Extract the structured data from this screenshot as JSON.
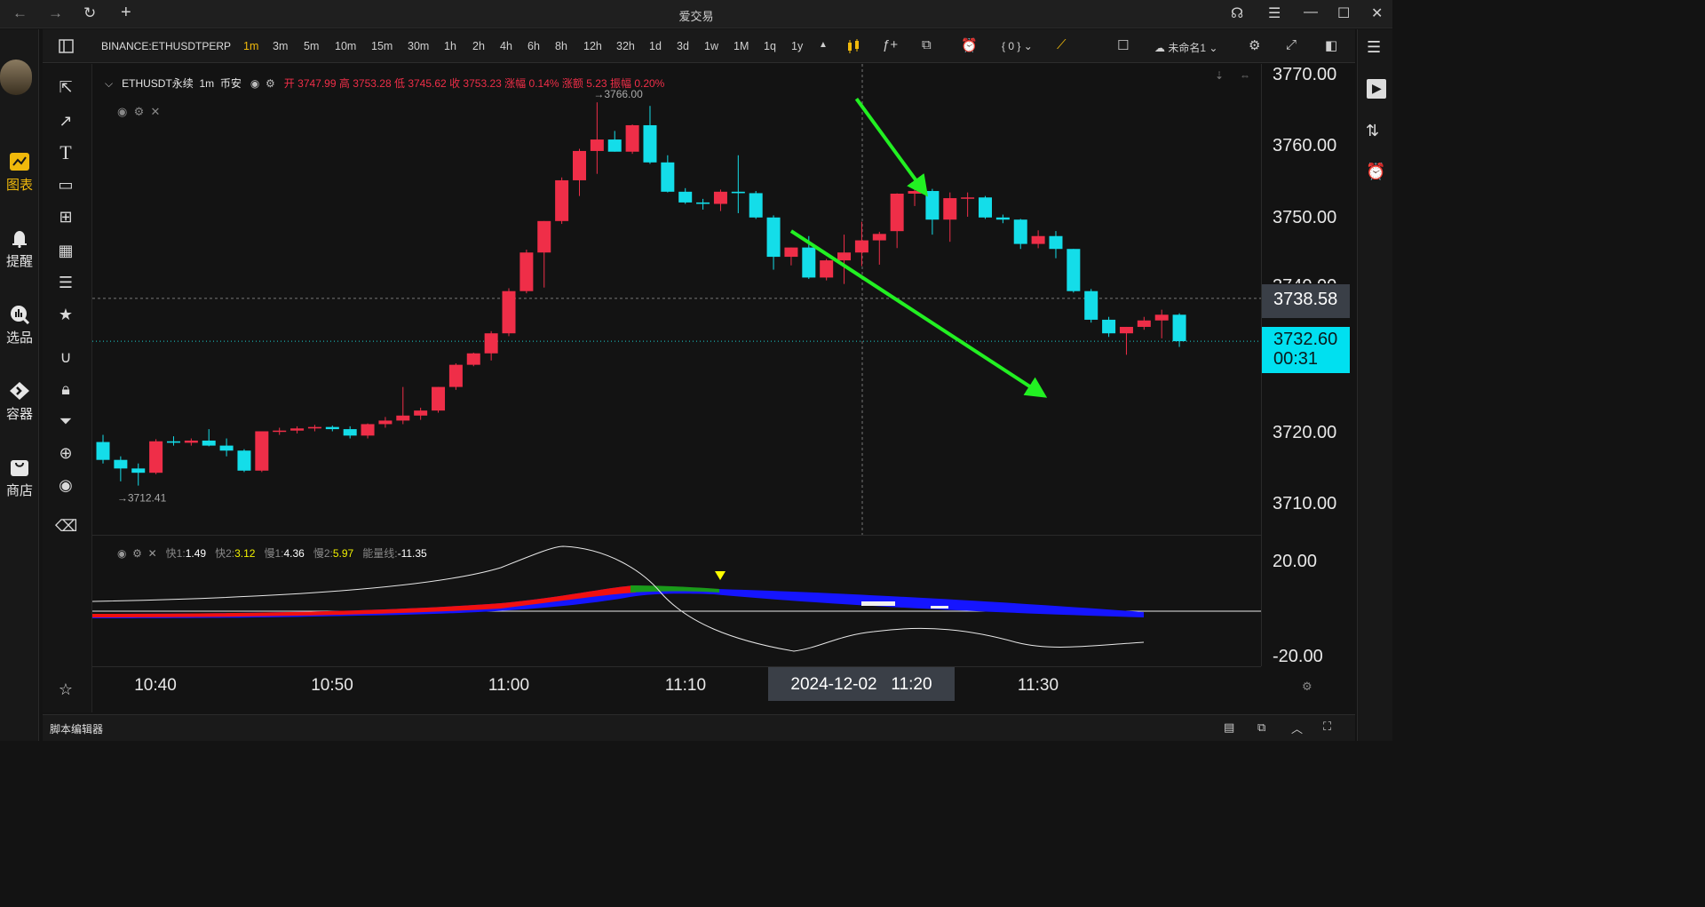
{
  "window": {
    "title": "爱交易"
  },
  "left_nav": [
    {
      "label": "图表",
      "active": true,
      "icon": "chart-icon"
    },
    {
      "label": "提醒",
      "active": false,
      "icon": "bell-icon"
    },
    {
      "label": "选品",
      "active": false,
      "icon": "stock-picker-icon"
    },
    {
      "label": "容器",
      "active": false,
      "icon": "container-icon"
    },
    {
      "label": "商店",
      "active": false,
      "icon": "store-icon"
    }
  ],
  "toolbar": {
    "symbol": "BINANCE:ETHUSDTPERP",
    "timeframes": [
      "1m",
      "3m",
      "5m",
      "10m",
      "15m",
      "30m",
      "1h",
      "2h",
      "4h",
      "6h",
      "8h",
      "12h",
      "32h",
      "1d",
      "3d",
      "1w",
      "1M",
      "1q",
      "1y"
    ],
    "active_timeframe": "1m",
    "indicator_count": "{ 0 }",
    "layout_name": "未命名1"
  },
  "legend": {
    "name": "ETHUSDT永续",
    "interval": "1m",
    "exchange": "币安",
    "open_label": "开",
    "open": "3747.99",
    "high_label": "高",
    "high": "3753.28",
    "low_label": "低",
    "low": "3745.62",
    "close_label": "收",
    "close": "3753.23",
    "chg_pct_label": "涨幅",
    "chg_pct": "0.14%",
    "chg_label": "涨额",
    "chg": "5.23",
    "amp_label": "振幅",
    "amp": "0.20%"
  },
  "indicator": {
    "fast1_label": "快1:",
    "fast1": "1.49",
    "fast2_label": "快2:",
    "fast2": "3.12",
    "slow1_label": "慢1:",
    "slow1": "4.36",
    "slow2_label": "慢2:",
    "slow2": "5.97",
    "energy_label": "能量线:",
    "energy": "-11.35",
    "axis_top": "20.00",
    "axis_bottom": "-20.00"
  },
  "price_axis": [
    "3770.00",
    "3760.00",
    "3750.00",
    "3740.00",
    "3720.00",
    "3710.00"
  ],
  "crosshair_price": "3738.58",
  "last_price": "3732.60",
  "countdown": "00:31",
  "time_axis": [
    "10:40",
    "10:50",
    "11:00",
    "11:10",
    "11:30"
  ],
  "crosshair_time": "2024-12-02   11:20",
  "annotations": {
    "high_mark": "→3766.00",
    "low_mark": "→3712.41"
  },
  "status_bar": {
    "script_editor": "脚本编辑器"
  },
  "colors": {
    "up": "#ef2e48",
    "down": "#14dde9",
    "accent": "#f0b90b",
    "arrow": "#22f022",
    "last_price_bg": "#00e0f0"
  },
  "chart_data": {
    "type": "candlestick",
    "interval": "1m",
    "start_time": "10:37",
    "ylim": [
      3705,
      3770
    ],
    "candles": [
      {
        "o": 3718.5,
        "h": 3719.5,
        "l": 3715.5,
        "c": 3716.0
      },
      {
        "o": 3716.0,
        "h": 3716.5,
        "l": 3713.0,
        "c": 3714.8
      },
      {
        "o": 3714.8,
        "h": 3715.5,
        "l": 3712.41,
        "c": 3714.2
      },
      {
        "o": 3714.2,
        "h": 3718.9,
        "l": 3714.0,
        "c": 3718.6
      },
      {
        "o": 3718.6,
        "h": 3719.3,
        "l": 3718.0,
        "c": 3718.4
      },
      {
        "o": 3718.4,
        "h": 3719.0,
        "l": 3718.0,
        "c": 3718.7
      },
      {
        "o": 3718.7,
        "h": 3720.3,
        "l": 3717.9,
        "c": 3718.0
      },
      {
        "o": 3718.0,
        "h": 3719.0,
        "l": 3716.5,
        "c": 3717.3
      },
      {
        "o": 3717.3,
        "h": 3717.5,
        "l": 3714.3,
        "c": 3714.5
      },
      {
        "o": 3714.5,
        "h": 3720.0,
        "l": 3714.3,
        "c": 3720.0
      },
      {
        "o": 3720.0,
        "h": 3720.5,
        "l": 3719.5,
        "c": 3720.1
      },
      {
        "o": 3720.1,
        "h": 3720.7,
        "l": 3719.7,
        "c": 3720.4
      },
      {
        "o": 3720.4,
        "h": 3720.9,
        "l": 3720.0,
        "c": 3720.6
      },
      {
        "o": 3720.6,
        "h": 3720.8,
        "l": 3720.0,
        "c": 3720.3
      },
      {
        "o": 3720.3,
        "h": 3720.7,
        "l": 3719.0,
        "c": 3719.4
      },
      {
        "o": 3719.4,
        "h": 3721.1,
        "l": 3719.0,
        "c": 3721.0
      },
      {
        "o": 3721.0,
        "h": 3722.0,
        "l": 3720.5,
        "c": 3721.5
      },
      {
        "o": 3721.5,
        "h": 3726.2,
        "l": 3721.0,
        "c": 3722.2
      },
      {
        "o": 3722.2,
        "h": 3723.3,
        "l": 3721.6,
        "c": 3722.9
      },
      {
        "o": 3722.9,
        "h": 3726.2,
        "l": 3722.6,
        "c": 3726.2
      },
      {
        "o": 3726.2,
        "h": 3729.5,
        "l": 3725.8,
        "c": 3729.3
      },
      {
        "o": 3729.3,
        "h": 3731.0,
        "l": 3729.1,
        "c": 3730.9
      },
      {
        "o": 3730.9,
        "h": 3734.0,
        "l": 3729.9,
        "c": 3733.7
      },
      {
        "o": 3733.7,
        "h": 3740.0,
        "l": 3733.3,
        "c": 3739.6
      },
      {
        "o": 3739.6,
        "h": 3745.4,
        "l": 3739.3,
        "c": 3745.0
      },
      {
        "o": 3745.0,
        "h": 3749.4,
        "l": 3740.1,
        "c": 3749.4
      },
      {
        "o": 3749.4,
        "h": 3755.5,
        "l": 3749.0,
        "c": 3755.1
      },
      {
        "o": 3755.1,
        "h": 3759.5,
        "l": 3752.9,
        "c": 3759.2
      },
      {
        "o": 3759.2,
        "h": 3766.0,
        "l": 3756.0,
        "c": 3760.8
      },
      {
        "o": 3760.8,
        "h": 3762.0,
        "l": 3759.1,
        "c": 3759.1
      },
      {
        "o": 3759.1,
        "h": 3762.9,
        "l": 3758.8,
        "c": 3762.8
      },
      {
        "o": 3762.8,
        "h": 3765.5,
        "l": 3757.4,
        "c": 3757.6
      },
      {
        "o": 3757.6,
        "h": 3758.6,
        "l": 3753.4,
        "c": 3753.5
      },
      {
        "o": 3753.5,
        "h": 3754.0,
        "l": 3751.8,
        "c": 3752.0
      },
      {
        "o": 3752.0,
        "h": 3752.5,
        "l": 3751.0,
        "c": 3751.8
      },
      {
        "o": 3751.8,
        "h": 3753.8,
        "l": 3750.8,
        "c": 3753.5
      },
      {
        "o": 3753.5,
        "h": 3758.6,
        "l": 3750.5,
        "c": 3753.3
      },
      {
        "o": 3753.3,
        "h": 3753.6,
        "l": 3749.7,
        "c": 3749.9
      },
      {
        "o": 3749.9,
        "h": 3750.2,
        "l": 3742.6,
        "c": 3744.4
      },
      {
        "o": 3744.4,
        "h": 3745.7,
        "l": 3743.2,
        "c": 3745.7
      },
      {
        "o": 3745.7,
        "h": 3747.3,
        "l": 3741.3,
        "c": 3741.5
      },
      {
        "o": 3741.5,
        "h": 3744.1,
        "l": 3741.1,
        "c": 3743.9
      },
      {
        "o": 3743.9,
        "h": 3747.5,
        "l": 3740.6,
        "c": 3745.0
      },
      {
        "o": 3745.0,
        "h": 3749.3,
        "l": 3743.1,
        "c": 3746.7
      },
      {
        "o": 3746.7,
        "h": 3747.9,
        "l": 3743.3,
        "c": 3747.6
      },
      {
        "o": 3747.99,
        "h": 3753.28,
        "l": 3745.62,
        "c": 3753.23
      },
      {
        "o": 3753.23,
        "h": 3753.9,
        "l": 3751.5,
        "c": 3753.6
      },
      {
        "o": 3753.6,
        "h": 3753.9,
        "l": 3747.5,
        "c": 3749.6
      },
      {
        "o": 3749.6,
        "h": 3753.4,
        "l": 3746.5,
        "c": 3752.6
      },
      {
        "o": 3752.6,
        "h": 3753.4,
        "l": 3750.0,
        "c": 3752.7
      },
      {
        "o": 3752.7,
        "h": 3752.9,
        "l": 3749.7,
        "c": 3749.9
      },
      {
        "o": 3749.9,
        "h": 3750.3,
        "l": 3749.1,
        "c": 3749.6
      },
      {
        "o": 3749.6,
        "h": 3749.7,
        "l": 3745.5,
        "c": 3746.2
      },
      {
        "o": 3746.2,
        "h": 3748.1,
        "l": 3745.6,
        "c": 3747.3
      },
      {
        "o": 3747.3,
        "h": 3748.0,
        "l": 3744.2,
        "c": 3745.5
      },
      {
        "o": 3745.5,
        "h": 3745.5,
        "l": 3739.4,
        "c": 3739.6
      },
      {
        "o": 3739.6,
        "h": 3739.9,
        "l": 3735.2,
        "c": 3735.6
      },
      {
        "o": 3735.6,
        "h": 3736.0,
        "l": 3733.2,
        "c": 3733.7
      },
      {
        "o": 3733.7,
        "h": 3734.6,
        "l": 3730.7,
        "c": 3734.6
      },
      {
        "o": 3734.6,
        "h": 3736.0,
        "l": 3734.2,
        "c": 3735.5
      },
      {
        "o": 3735.5,
        "h": 3737.0,
        "l": 3733.0,
        "c": 3736.3
      },
      {
        "o": 3736.3,
        "h": 3736.5,
        "l": 3731.8,
        "c": 3732.6
      }
    ],
    "arrows": [
      {
        "from": [
          3749.7,
          3766.5
        ],
        "to": [
          3753.4,
          3754.0
        ]
      },
      {
        "from": [
          3746.0,
          3748.0
        ],
        "to": [
          3760.0,
          3725.5
        ]
      }
    ]
  }
}
